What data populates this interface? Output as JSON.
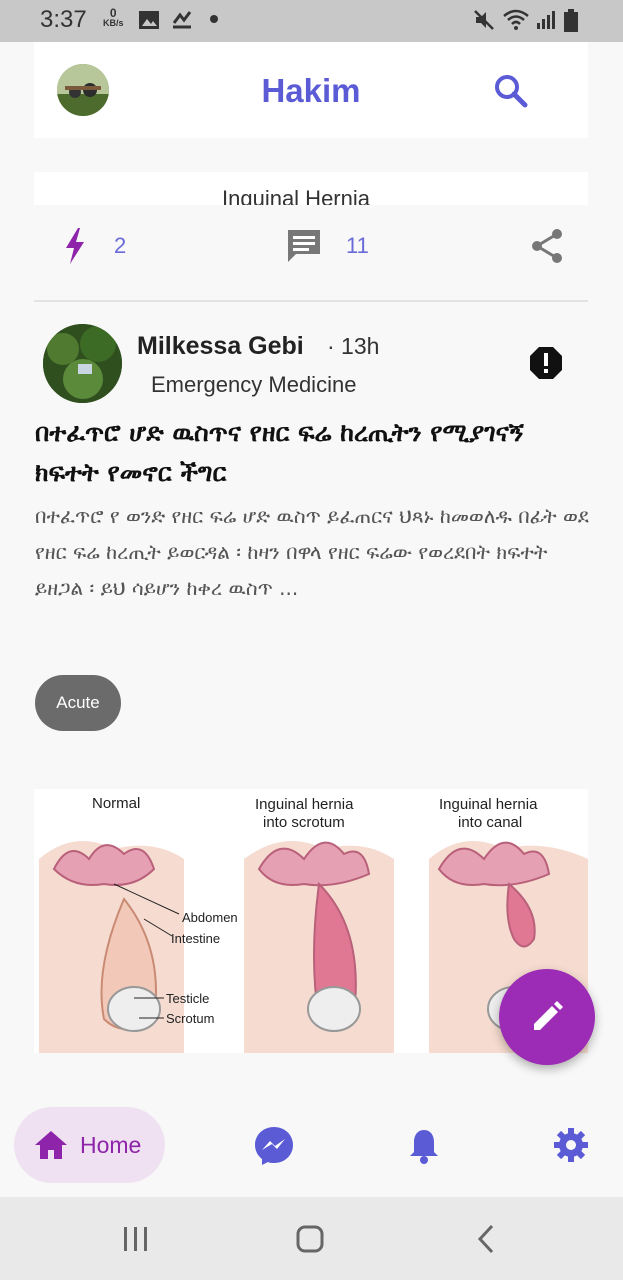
{
  "status_bar": {
    "time": "3:37",
    "net_speed_value": "0",
    "net_speed_unit": "KB/s"
  },
  "app_bar": {
    "title": "Hakim",
    "search_icon": "search-icon",
    "avatar_icon": "profile-avatar"
  },
  "previous_post": {
    "image_caption": "Inguinal Hernia",
    "like_count": "2",
    "comment_count": "11"
  },
  "post": {
    "author": "Milkessa Gebi",
    "time": "· 13h",
    "category": "Emergency Medicine",
    "title": "በተፈጥሮ ሆድ ዉስጥና የዘር ፍሬ ከረጢትን የሚያገናኝ ክፍተት የመኖር ችግር",
    "excerpt": "በተፈጥሮ የ ወንድ የዘር ፍሬ ሆድ ዉስጥ ይፈጠርና ህጻኑ ከመወለዱ በፊት ወደ የዘር ፍሬ ከረጢት ይወርዳል ፡ ከዛን በዋላ የዘር ፍሬው የወረደበት ክፍተት ይዘጋል ፡ ይህ ሳይሆን ከቀረ ዉስጥ ...",
    "tag": "Acute",
    "image_labels": {
      "normal": "Normal",
      "abdomen": "Abdomen",
      "intestine": "Intestine",
      "testicle": "Testicle",
      "scrotum": "Scrotum",
      "hernia_scrotum_1": "Inguinal hernia",
      "hernia_scrotum_2": "into scrotum",
      "hernia_canal_1": "Inguinal hernia",
      "hernia_canal_2": "into canal"
    }
  },
  "bottom_nav": {
    "home_label": "Home",
    "items": [
      "home-icon",
      "messenger-icon",
      "bell-icon",
      "gear-icon"
    ]
  },
  "colors": {
    "accent": "#5b5bd6",
    "fab": "#9c2bb5",
    "home_active": "#8e24aa",
    "chip": "#6b6b6b"
  }
}
